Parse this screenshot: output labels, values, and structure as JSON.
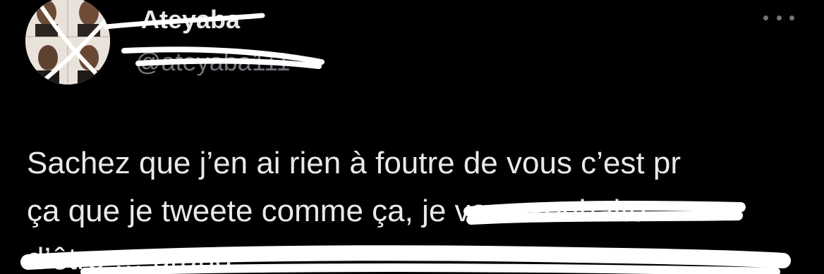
{
  "tweet": {
    "display_name": "Ateyaba",
    "handle": "@ateyaba111",
    "text_line_1": "Sachez que j’en ai rien à foutre de vous c’est pr",
    "text_line_2": "ça que je tweete comme ça, je vous souhaite",
    "text_line_3": "d’être … grand."
  },
  "icons": {
    "more": "more-horizontal-icon"
  },
  "colors": {
    "background": "#000000",
    "text": "#e7e9ea",
    "secondary": "#71767b",
    "scribble": "#ffffff"
  }
}
